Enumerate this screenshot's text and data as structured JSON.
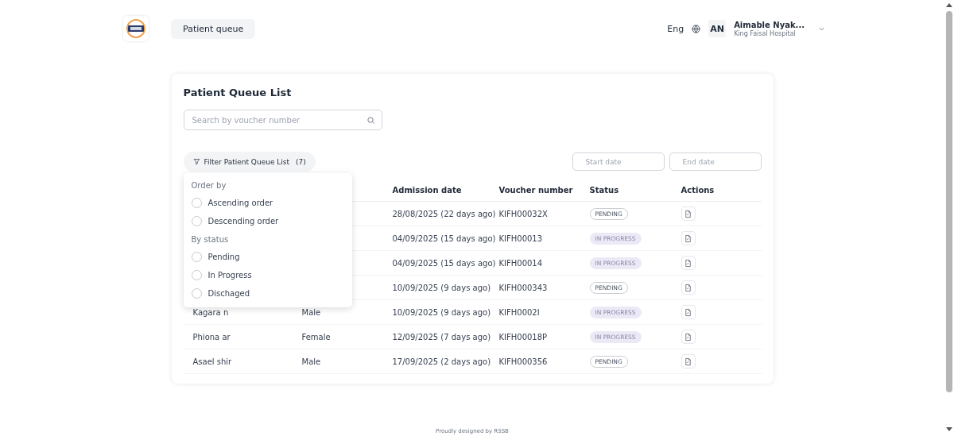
{
  "header": {
    "nav_tab": "Patient queue",
    "language": "Eng",
    "user": {
      "initials": "AN",
      "name": "Aimable Nyak...",
      "hospital": "King Faisal Hospital"
    }
  },
  "card": {
    "title": "Patient Queue List",
    "search": {
      "placeholder": "Search by voucher number"
    },
    "filter_button": {
      "label": "Filter Patient Queue List",
      "count": "(7)",
      "expanded": true
    },
    "start_date": {
      "placeholder": "Start date"
    },
    "end_date": {
      "placeholder": "End date"
    },
    "filter_menu": {
      "sections": [
        {
          "heading": "Order by",
          "options": [
            {
              "label": "Ascending order",
              "selected": false
            },
            {
              "label": "Descending order",
              "selected": false
            }
          ]
        },
        {
          "heading": "By status",
          "options": [
            {
              "label": "Pending",
              "selected": false
            },
            {
              "label": "In Progress",
              "selected": false
            },
            {
              "label": "Dischaged",
              "selected": false
            }
          ]
        }
      ]
    },
    "table": {
      "columns": [
        "Admission date",
        "Voucher number",
        "Status",
        "Actions"
      ],
      "rows": [
        {
          "admission": "28/08/2025 (22 days ago)",
          "voucher": "KIFH00032X",
          "status": {
            "label": "PENDING",
            "kind": "pending"
          }
        },
        {
          "admission": "04/09/2025 (15 days ago)",
          "voucher": "KIFH00013",
          "status": {
            "label": "IN PROGRESS",
            "kind": "in_progress"
          }
        },
        {
          "admission": "04/09/2025 (15 days ago)",
          "voucher": "KIFH00014",
          "status": {
            "label": "IN PROGRESS",
            "kind": "in_progress"
          }
        },
        {
          "admission": "10/09/2025 (9 days ago)",
          "voucher": "KIFH000343",
          "status": {
            "label": "PENDING",
            "kind": "pending"
          }
        },
        {
          "name": "Kagara n",
          "gender": "Male",
          "admission": "10/09/2025 (9 days ago)",
          "voucher": "KIFH0002I",
          "status": {
            "label": "IN PROGRESS",
            "kind": "in_progress"
          }
        },
        {
          "name": "Phiona ar",
          "gender": "Female",
          "admission": "12/09/2025 (7 days ago)",
          "voucher": "KIFH00018P",
          "status": {
            "label": "IN PROGRESS",
            "kind": "in_progress"
          }
        },
        {
          "name": "Asael shir",
          "gender": "Male",
          "admission": "17/09/2025 (2 days ago)",
          "voucher": "KIFH000356",
          "status": {
            "label": "PENDING",
            "kind": "pending"
          }
        }
      ]
    }
  },
  "footer": "Proudly designed by RSSB"
}
